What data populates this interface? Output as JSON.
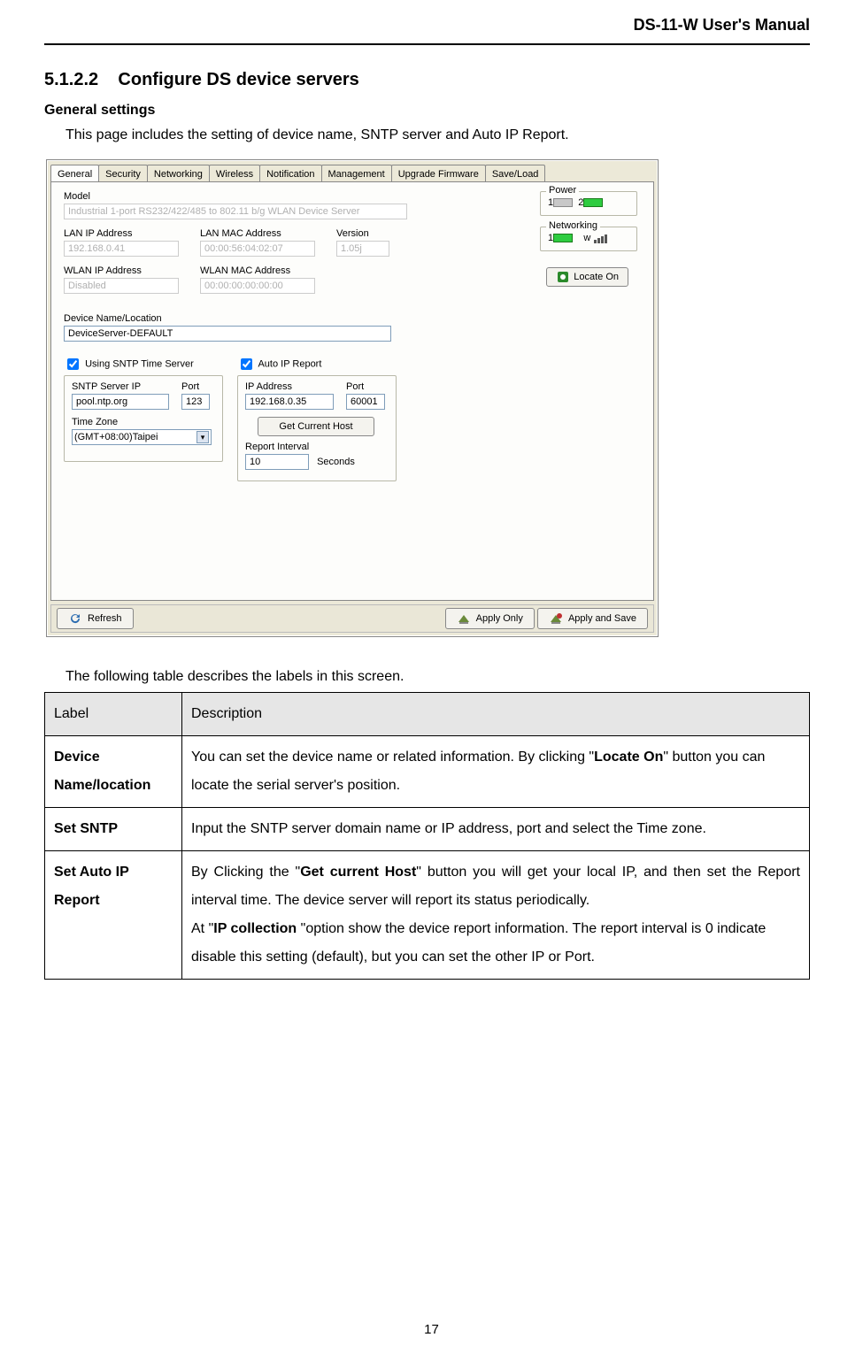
{
  "doc": {
    "header": "DS-11-W User's Manual",
    "section_number": "5.1.2.2",
    "section_title": "Configure DS device servers",
    "subheading": "General settings",
    "intro": "This page includes the setting of device name, SNTP server and Auto IP Report.",
    "table_intro": "The following table describes the labels in this screen.",
    "page_number": "17"
  },
  "app": {
    "tabs": [
      "General",
      "Security",
      "Networking",
      "Wireless",
      "Notification",
      "Management",
      "Upgrade Firmware",
      "Save/Load"
    ],
    "model": {
      "label": "Model",
      "value": "Industrial 1-port RS232/422/485 to 802.11 b/g WLAN Device Server"
    },
    "lan_ip": {
      "label": "LAN IP Address",
      "value": "192.168.0.41"
    },
    "lan_mac": {
      "label": "LAN MAC Address",
      "value": "00:00:56:04:02:07"
    },
    "version": {
      "label": "Version",
      "value": "1.05j"
    },
    "wlan_ip": {
      "label": "WLAN IP Address",
      "value": "Disabled"
    },
    "wlan_mac": {
      "label": "WLAN MAC Address",
      "value": "00:00:00:00:00:00"
    },
    "device_name": {
      "label": "Device Name/Location",
      "value": "DeviceServer-DEFAULT"
    },
    "sntp": {
      "check_label": "Using SNTP Time Server",
      "server_label": "SNTP Server IP",
      "server_value": "pool.ntp.org",
      "port_label": "Port",
      "port_value": "123",
      "tz_label": "Time Zone",
      "tz_value": "(GMT+08:00)Taipei"
    },
    "autoip": {
      "check_label": "Auto IP Report",
      "ip_label": "IP Address",
      "ip_value": "192.168.0.35",
      "port_label": "Port",
      "port_value": "60001",
      "get_host_btn": "Get Current Host",
      "interval_label": "Report Interval",
      "interval_value": "10",
      "interval_unit": "Seconds"
    },
    "status": {
      "power_label": "Power",
      "net_label": "Networking",
      "net_wlabel": "w",
      "locate_btn": "Locate On"
    },
    "buttons": {
      "refresh": "Refresh",
      "apply_only": "Apply Only",
      "apply_save": "Apply and Save"
    }
  },
  "table": {
    "headers": {
      "label": "Label",
      "desc": "Description"
    },
    "rows": [
      {
        "label": "Device Name/location",
        "desc_pre": "You can set the device name or related information.  By clicking \"",
        "desc_bold1": "Locate On",
        "desc_post": "\" button you can locate the serial server's position."
      },
      {
        "label": "Set SNTP",
        "desc": "Input the SNTP server domain name or IP address, port and select the Time zone."
      },
      {
        "label": "Set Auto IP Report",
        "p1_pre": "By Clicking the \"",
        "p1_bold": "Get current Host",
        "p1_post": "\" button you will get your local IP, and then set the Report interval time.  The device server will report its status periodically.",
        "p2_pre": "At \"",
        "p2_bold": "IP collection ",
        "p2_post": "\"option show the device report information.  The report interval is 0 indicate disable this setting (default), but you can set the other IP or Port."
      }
    ]
  }
}
